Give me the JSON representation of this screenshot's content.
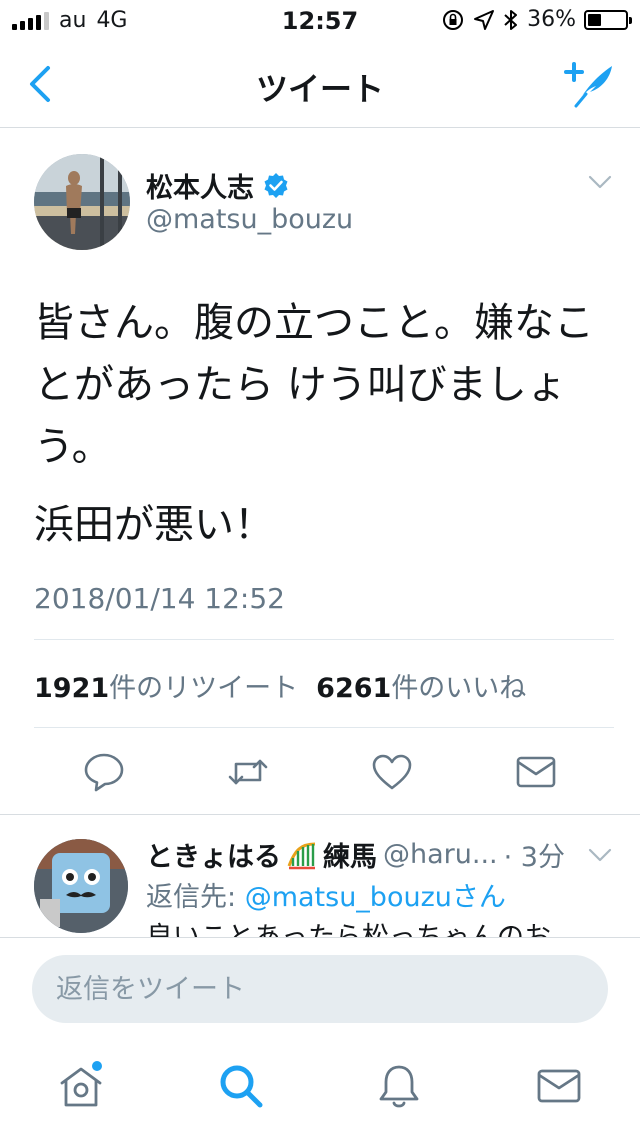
{
  "status_bar": {
    "carrier": "au",
    "network": "4G",
    "time": "12:57",
    "battery": "36%",
    "battery_level": 0.36
  },
  "nav": {
    "title": "ツイート"
  },
  "tweet": {
    "author_name": "松本人志",
    "author_handle": "@matsu_bouzu",
    "text_line1": "皆さん。腹の立つこと。嫌なことがあったら けう叫びましょう。",
    "text_line2": "浜田が悪い！",
    "timestamp": "2018/01/14 12:52",
    "retweet_count": "1921",
    "retweet_label": "件のリツイート",
    "like_count": "6261",
    "like_label": "件のいいね"
  },
  "reply": {
    "name": "ときょはる",
    "name_suffix": "練馬",
    "handle": "@haru...",
    "time": "· 3分",
    "reply_to_label": "返信先: ",
    "reply_to_mention": "@matsu_bouzuさん",
    "body": "良いことあったら松っちゃんのお"
  },
  "composer": {
    "placeholder": "返信をツイート"
  },
  "colors": {
    "accent": "#1da1f2",
    "secondary_text": "#657786",
    "divider": "#e1e8ed"
  },
  "icons": {
    "back": "chevron-left-icon",
    "compose": "compose-tweet-icon",
    "verified": "verified-badge-icon",
    "reply": "reply-icon",
    "retweet": "retweet-icon",
    "like": "heart-icon",
    "dm": "envelope-icon",
    "home": "home-icon",
    "search": "search-icon",
    "notifications": "bell-icon",
    "messages": "envelope-icon"
  }
}
